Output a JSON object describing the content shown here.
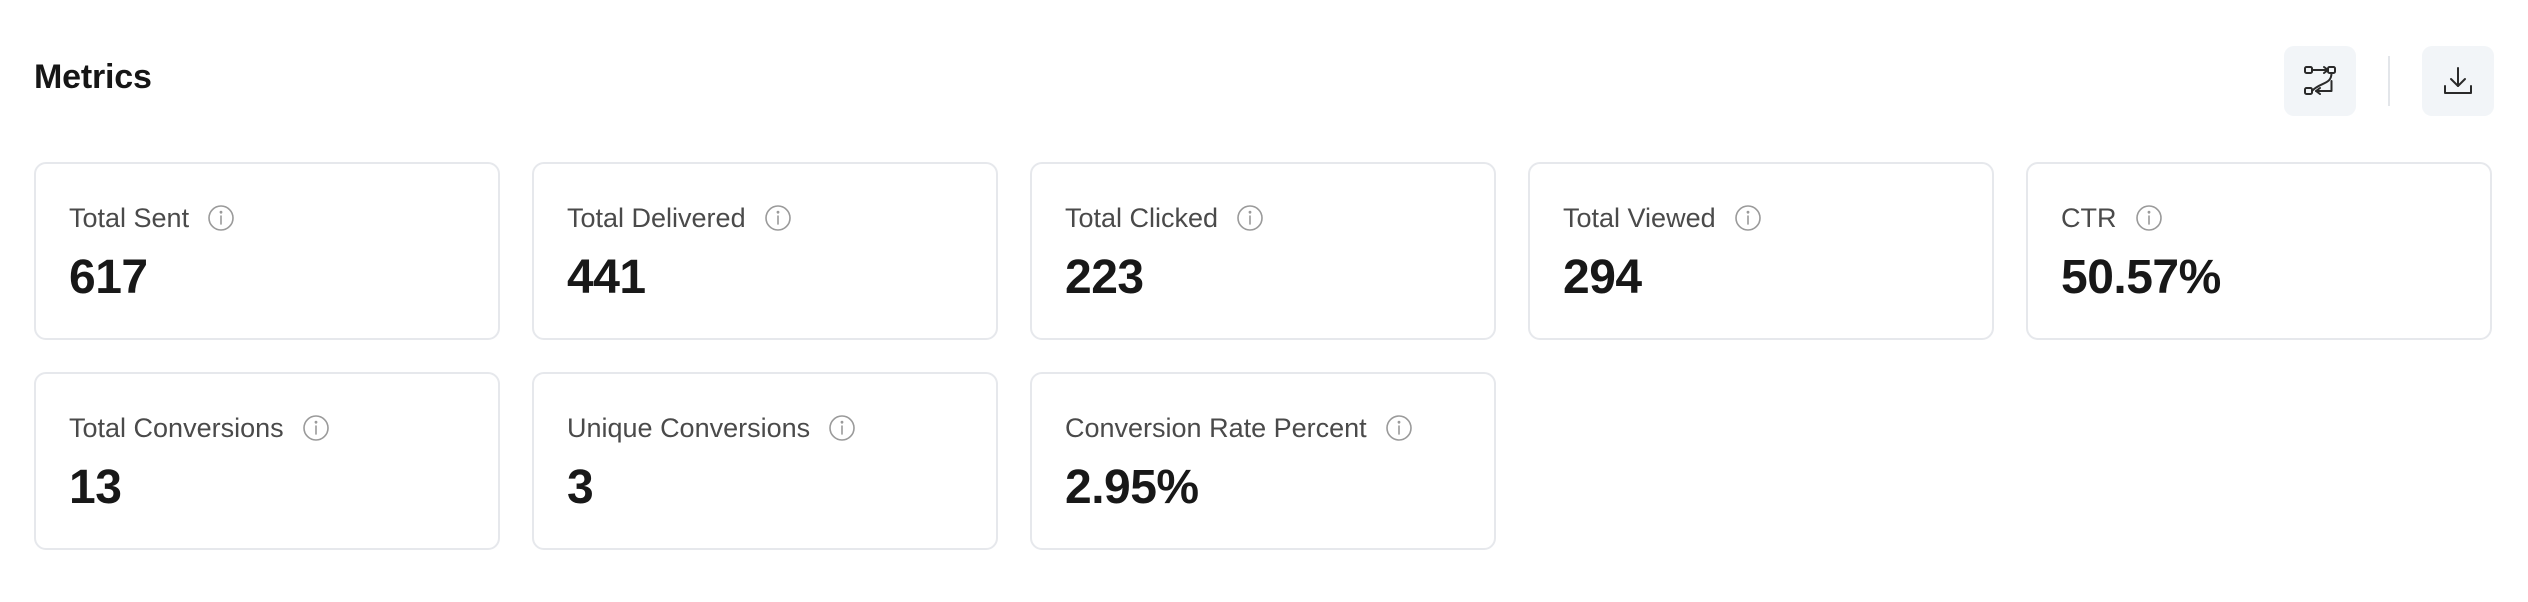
{
  "header": {
    "title": "Metrics",
    "actions": [
      {
        "icon": "flow-icon",
        "label": ""
      },
      {
        "icon": "download-icon",
        "label": ""
      }
    ]
  },
  "metrics": [
    {
      "label": "Total Sent",
      "value": "617"
    },
    {
      "label": "Total Delivered",
      "value": "441"
    },
    {
      "label": "Total Clicked",
      "value": "223"
    },
    {
      "label": "Total Viewed",
      "value": "294"
    },
    {
      "label": "CTR",
      "value": "50.57%"
    },
    {
      "label": "Total Conversions",
      "value": "13"
    },
    {
      "label": "Unique Conversions",
      "value": "3"
    },
    {
      "label": "Conversion Rate Percent",
      "value": "2.95%"
    }
  ],
  "colors": {
    "card_border": "#e6e8ec",
    "button_bg": "#f2f5f8",
    "text_primary": "#181818",
    "text_label": "#4a4a4a",
    "icon_stroke": "#9a9a9a"
  }
}
